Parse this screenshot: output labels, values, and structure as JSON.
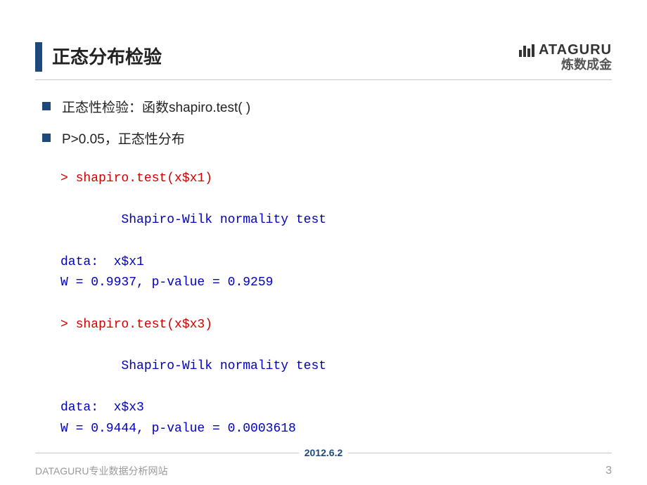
{
  "title": "正态分布检验",
  "logo": {
    "top": "ATAGURU",
    "bottom": "炼数成金"
  },
  "bullets": [
    "正态性检验：函数shapiro.test( )",
    "P>0.05，正态性分布"
  ],
  "code": {
    "cmd1": "> shapiro.test(x$x1)",
    "heading1": "        Shapiro-Wilk normality test",
    "data1": "data:  x$x1",
    "result1": "W = 0.9937, p-value = 0.9259",
    "cmd2": "> shapiro.test(x$x3)",
    "heading2": "        Shapiro-Wilk normality test",
    "data2": "data:  x$x3",
    "result2": "W = 0.9444, p-value = 0.0003618"
  },
  "footer": {
    "date": "2012.6.2",
    "site": "DATAGURU专业数据分析网站",
    "page": "3"
  }
}
